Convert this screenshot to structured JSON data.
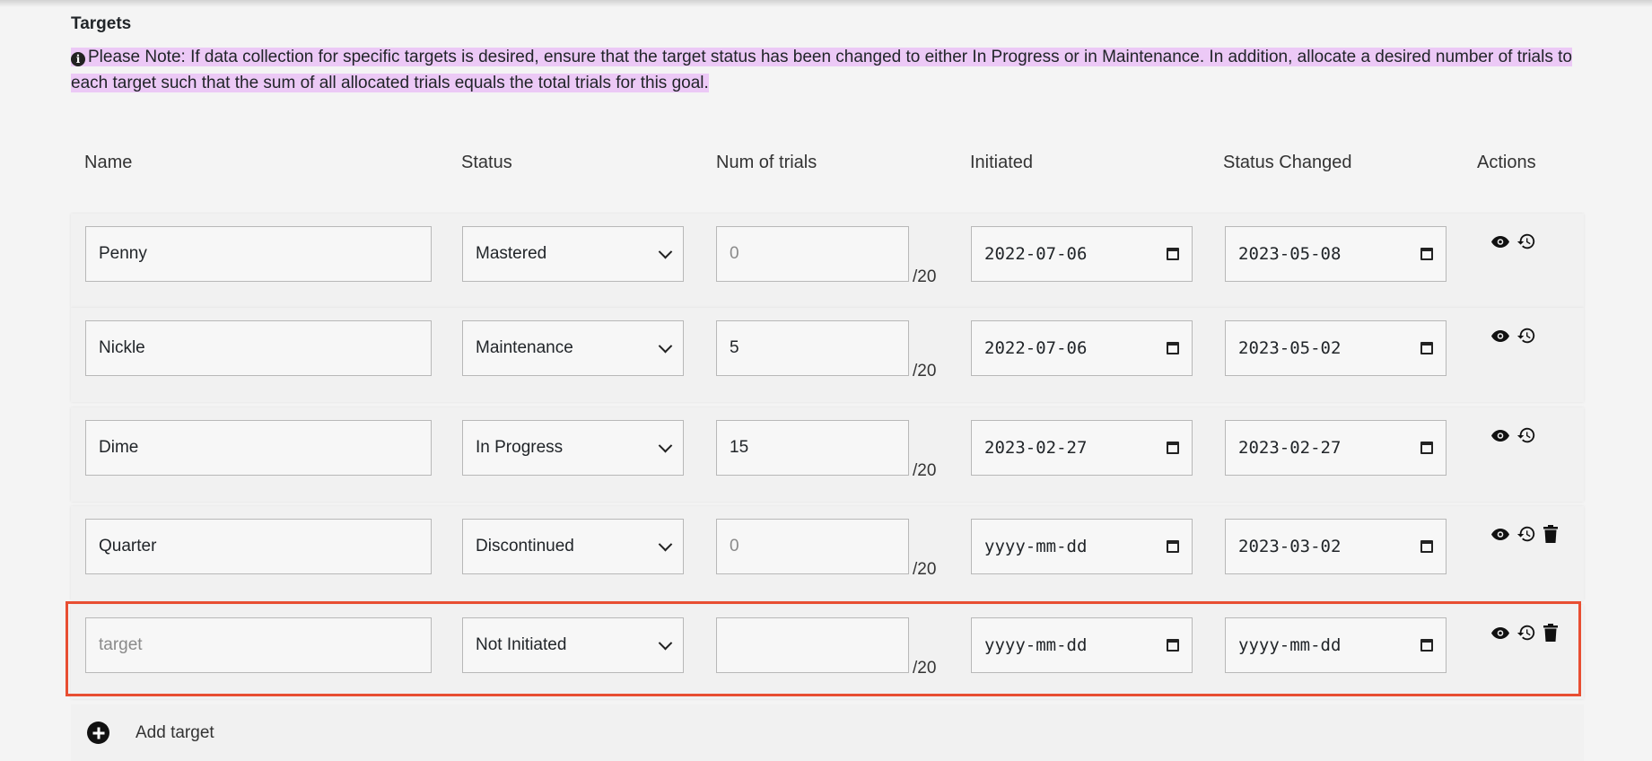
{
  "section": {
    "title": "Targets",
    "note": "Please Note: If data collection for specific targets is desired, ensure that the target status has been changed to either In Progress or in Maintenance. In addition, allocate a desired number of trials to each target such that the sum of all allocated trials equals the total trials for this goal."
  },
  "columns": {
    "name": "Name",
    "status": "Status",
    "trials": "Num of trials",
    "initiated": "Initiated",
    "changed": "Status Changed",
    "actions": "Actions"
  },
  "rows": [
    {
      "name": "Penny",
      "status": "Mastered",
      "trials": "0",
      "trials_placeholder": true,
      "denominator": "/20",
      "initiated": "2022-07-06",
      "changed": "2023-05-08",
      "deletable": false
    },
    {
      "name": "Nickle",
      "status": "Maintenance",
      "trials": "5",
      "trials_placeholder": false,
      "denominator": "/20",
      "initiated": "2022-07-06",
      "changed": "2023-05-02",
      "deletable": false
    },
    {
      "name": "Dime",
      "status": "In Progress",
      "trials": "15",
      "trials_placeholder": false,
      "denominator": "/20",
      "initiated": "2023-02-27",
      "changed": "2023-02-27",
      "deletable": false
    },
    {
      "name": "Quarter",
      "status": "Discontinued",
      "trials": "0",
      "trials_placeholder": true,
      "denominator": "/20",
      "initiated": "yyyy-mm-dd",
      "changed": "2023-03-02",
      "deletable": true
    },
    {
      "name": "",
      "name_placeholder": "target",
      "status": "Not Initiated",
      "trials": "",
      "trials_placeholder": false,
      "denominator": "/20",
      "initiated": "yyyy-mm-dd",
      "changed": "yyyy-mm-dd",
      "deletable": true
    }
  ],
  "add_target": {
    "label": "Add target"
  },
  "colors": {
    "note_highlight": "#ecc9f6",
    "selection_border": "#e84e32"
  },
  "icons": [
    "info-icon",
    "eye-icon",
    "history-icon",
    "trash-icon",
    "chevron-down-icon",
    "calendar-icon",
    "plus-circle-icon"
  ]
}
